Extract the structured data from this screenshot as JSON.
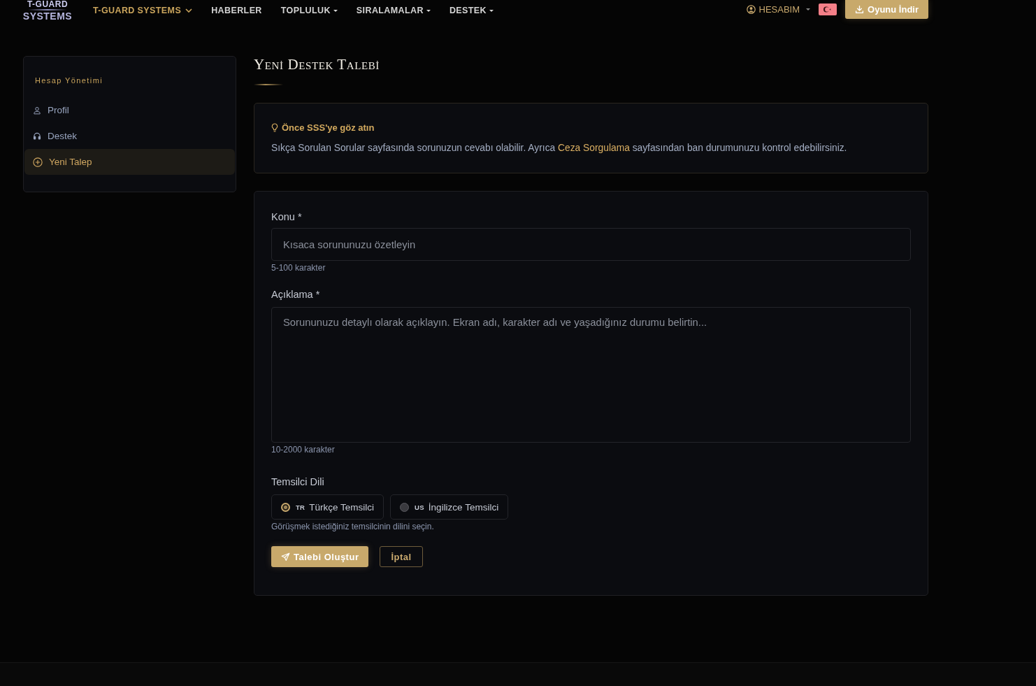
{
  "nav": {
    "logo": [
      "T-GUARD",
      "SYSTEMS"
    ],
    "items": [
      {
        "label": "T-GUARD SYSTEMS",
        "kind": "menu",
        "selected": true
      },
      {
        "label": "HABERLER",
        "kind": "link",
        "selected": false
      },
      {
        "label": "TOPLULUK",
        "kind": "dropdown",
        "selected": false
      },
      {
        "label": "SIRALAMALAR",
        "kind": "dropdown",
        "selected": false
      },
      {
        "label": "DESTEK",
        "kind": "dropdown",
        "selected": false
      }
    ],
    "account": {
      "label": "HESABIM"
    },
    "download_button": "Oyunu İndir"
  },
  "sidebar": {
    "heading": "Hesap Yönetimi",
    "items": [
      {
        "label": "Profil",
        "selected": false
      },
      {
        "label": "Destek",
        "selected": false
      },
      {
        "label": "Yeni Talep",
        "selected": true
      }
    ]
  },
  "page_title": "Yeni Destek Talebi",
  "notice": {
    "title": "Önce SSS'ye göz atın",
    "text_before": "Sıkça Sorulan Sorular sayfasında sorunuzun cevabı olabilir. Ayrıca ",
    "link": "Ceza Sorgulama",
    "text_after": " sayfasından ban durumunuzu kontrol edebilirsiniz."
  },
  "form": {
    "subject": {
      "label": "Konu *",
      "placeholder": "Kısaca sorununuzu özetleyin",
      "hint": "5-100 karakter"
    },
    "description": {
      "label": "Açıklama *",
      "placeholder": "Sorununuzu detaylı olarak açıklayın. Ekran adı, karakter adı ve yaşadığınız durumu belirtin...",
      "hint": "10-2000 karakter"
    },
    "language": {
      "label": "Temsilci Dili",
      "options": [
        {
          "code": "TR",
          "label": "Türkçe Temsilci",
          "selected": true
        },
        {
          "code": "US",
          "label": "İngilizce Temsilci",
          "selected": false
        }
      ],
      "hint": "Görüşmek istediğiniz temsilcinin dilini seçin."
    },
    "buttons": [
      {
        "label": "Talebi Oluştur",
        "kind": "primary"
      },
      {
        "label": "İptal",
        "kind": "secondary"
      }
    ]
  }
}
